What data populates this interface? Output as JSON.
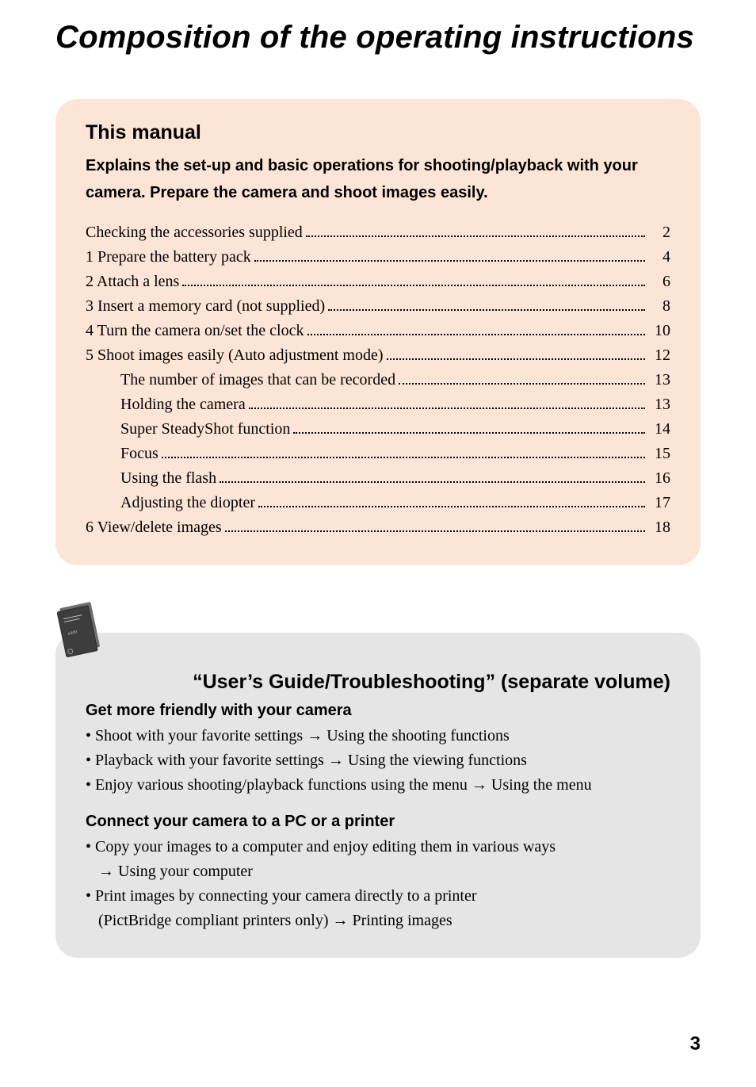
{
  "pageTitle": "Composition of the operating instructions",
  "box1": {
    "heading": "This manual",
    "sub": "Explains the set-up and basic operations for shooting/playback with your camera. Prepare the camera and shoot images easily.",
    "toc": [
      {
        "label": "Checking the accessories supplied",
        "page": "2",
        "indent": false
      },
      {
        "label": "1 Prepare the battery pack",
        "page": "4",
        "indent": false
      },
      {
        "label": "2 Attach a lens",
        "page": "6",
        "indent": false
      },
      {
        "label": "3 Insert a memory card (not supplied)",
        "page": "8",
        "indent": false
      },
      {
        "label": "4 Turn the camera on/set the clock",
        "page": "10",
        "indent": false
      },
      {
        "label": "5 Shoot images easily (Auto adjustment mode)",
        "page": "12",
        "indent": false
      },
      {
        "label": "The number of images that can be recorded",
        "page": "13",
        "indent": true
      },
      {
        "label": "Holding the camera",
        "page": "13",
        "indent": true
      },
      {
        "label": "Super SteadyShot function",
        "page": "14",
        "indent": true
      },
      {
        "label": "Focus",
        "page": "15",
        "indent": true
      },
      {
        "label": "Using the flash",
        "page": "16",
        "indent": true
      },
      {
        "label": "Adjusting the diopter",
        "page": "17",
        "indent": true
      },
      {
        "label": "6 View/delete images",
        "page": "18",
        "indent": false
      }
    ]
  },
  "box2": {
    "title": "“User’s Guide/Troubleshooting” (separate volume)",
    "section1": {
      "heading": "Get more friendly with your camera",
      "bullets": [
        "• Shoot with your favorite settings → Using the shooting functions",
        "• Playback with your favorite settings → Using the viewing functions",
        "• Enjoy various shooting/playback functions using the menu → Using the menu"
      ]
    },
    "section2": {
      "heading": "Connect your camera to a PC or a printer",
      "bullets": [
        {
          "line1": "• Copy your images to a computer and enjoy editing them in various ways",
          "line2": "→ Using your computer"
        },
        {
          "line1": "• Print images by connecting your camera directly to a printer",
          "line2": "(PictBridge compliant printers only) → Printing images"
        }
      ]
    }
  },
  "pageNumber": "3"
}
